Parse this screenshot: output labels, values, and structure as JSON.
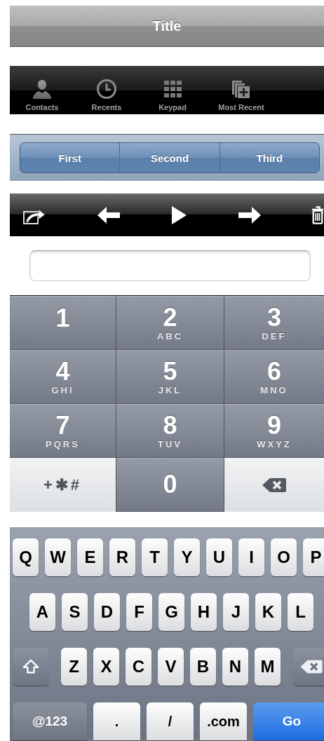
{
  "title_bar": {
    "title": "Title"
  },
  "tab_bar": {
    "items": [
      {
        "label": "Contacts",
        "kind": "person",
        "selected": false
      },
      {
        "label": "Recents",
        "kind": "clock",
        "selected": false
      },
      {
        "label": "Keypad",
        "kind": "grid",
        "selected": false
      },
      {
        "label": "Most Recent",
        "kind": "stack",
        "selected": false
      }
    ]
  },
  "segmented_control": {
    "segments": [
      {
        "label": "First",
        "selected": false
      },
      {
        "label": "Second",
        "selected": false
      },
      {
        "label": "Third",
        "selected": false
      }
    ]
  },
  "toolbar": {
    "buttons": [
      {
        "kind": "share"
      },
      {
        "kind": "back"
      },
      {
        "kind": "play"
      },
      {
        "kind": "forward"
      },
      {
        "kind": "trash"
      }
    ]
  },
  "keypad": {
    "keys": [
      {
        "kind": "digit",
        "digit": "1"
      },
      {
        "kind": "digit",
        "digit": "2",
        "letters": "ABC"
      },
      {
        "kind": "digit",
        "digit": "3",
        "letters": "DEF"
      },
      {
        "kind": "digit",
        "digit": "4",
        "letters": "GHI"
      },
      {
        "kind": "digit",
        "digit": "5",
        "letters": "JKL"
      },
      {
        "kind": "digit",
        "digit": "6",
        "letters": "MNO"
      },
      {
        "kind": "digit",
        "digit": "7",
        "letters": "PQRS"
      },
      {
        "kind": "digit",
        "digit": "8",
        "letters": "TUV"
      },
      {
        "kind": "digit",
        "digit": "9",
        "letters": "WXYZ"
      },
      {
        "kind": "symbols",
        "label": "+✱#"
      },
      {
        "kind": "digit",
        "digit": "0"
      },
      {
        "kind": "delete"
      }
    ]
  },
  "keyboard": {
    "rows": [
      {
        "keys": [
          {
            "kind": "letter",
            "label": "Q"
          },
          {
            "kind": "letter",
            "label": "W"
          },
          {
            "kind": "letter",
            "label": "E"
          },
          {
            "kind": "letter",
            "label": "R"
          },
          {
            "kind": "letter",
            "label": "T"
          },
          {
            "kind": "letter",
            "label": "Y"
          },
          {
            "kind": "letter",
            "label": "U"
          },
          {
            "kind": "letter",
            "label": "I"
          },
          {
            "kind": "letter",
            "label": "O"
          },
          {
            "kind": "letter",
            "label": "P"
          }
        ]
      },
      {
        "keys": [
          {
            "kind": "letter",
            "label": "A"
          },
          {
            "kind": "letter",
            "label": "S"
          },
          {
            "kind": "letter",
            "label": "D"
          },
          {
            "kind": "letter",
            "label": "F"
          },
          {
            "kind": "letter",
            "label": "G"
          },
          {
            "kind": "letter",
            "label": "H"
          },
          {
            "kind": "letter",
            "label": "J"
          },
          {
            "kind": "letter",
            "label": "K"
          },
          {
            "kind": "letter",
            "label": "L"
          }
        ]
      },
      {
        "keys": [
          {
            "kind": "shift"
          },
          {
            "kind": "letter",
            "label": "Z"
          },
          {
            "kind": "letter",
            "label": "X"
          },
          {
            "kind": "letter",
            "label": "C"
          },
          {
            "kind": "letter",
            "label": "V"
          },
          {
            "kind": "letter",
            "label": "B"
          },
          {
            "kind": "letter",
            "label": "N"
          },
          {
            "kind": "letter",
            "label": "M"
          },
          {
            "kind": "delete"
          }
        ]
      },
      {
        "keys": [
          {
            "kind": "mode",
            "label": "@123"
          },
          {
            "kind": "punct",
            "label": "."
          },
          {
            "kind": "punct",
            "label": "/"
          },
          {
            "kind": "punct",
            "label": ".com"
          },
          {
            "kind": "action",
            "label": "Go"
          }
        ]
      }
    ]
  }
}
